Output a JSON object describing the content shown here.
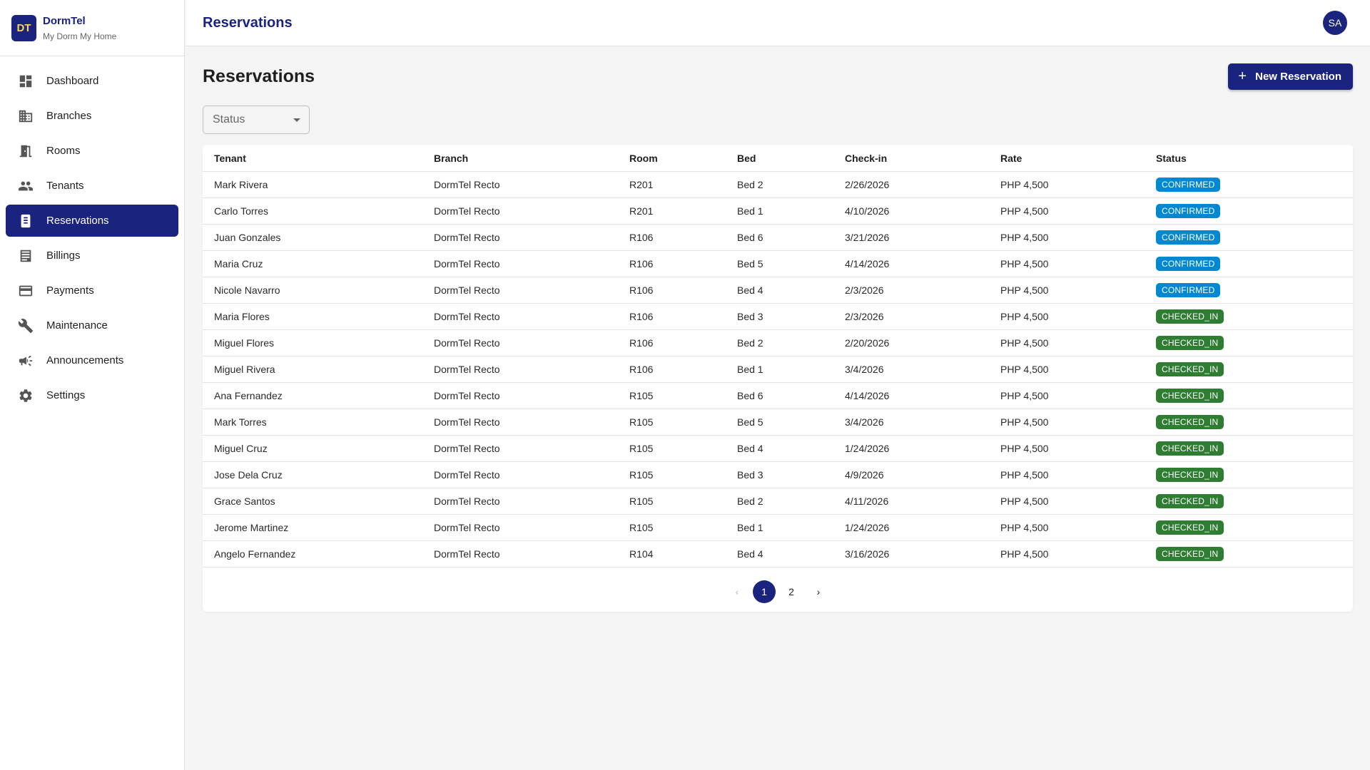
{
  "brand": {
    "logo": "DT",
    "name": "DormTel",
    "tagline": "My Dorm My Home"
  },
  "nav": [
    {
      "label": "Dashboard",
      "icon": "dashboard-icon",
      "active": false
    },
    {
      "label": "Branches",
      "icon": "building-icon",
      "active": false
    },
    {
      "label": "Rooms",
      "icon": "door-icon",
      "active": false
    },
    {
      "label": "Tenants",
      "icon": "people-icon",
      "active": false
    },
    {
      "label": "Reservations",
      "icon": "reservation-icon",
      "active": true
    },
    {
      "label": "Billings",
      "icon": "receipt-icon",
      "active": false
    },
    {
      "label": "Payments",
      "icon": "credit-card-icon",
      "active": false
    },
    {
      "label": "Maintenance",
      "icon": "wrench-icon",
      "active": false
    },
    {
      "label": "Announcements",
      "icon": "megaphone-icon",
      "active": false
    },
    {
      "label": "Settings",
      "icon": "gear-icon",
      "active": false
    }
  ],
  "topbar": {
    "title": "Reservations",
    "avatar": "SA"
  },
  "page": {
    "title": "Reservations",
    "new_button": "New Reservation",
    "plus": "+"
  },
  "filter": {
    "status_label": "Status"
  },
  "table": {
    "headers": [
      "Tenant",
      "Branch",
      "Room",
      "Bed",
      "Check-in",
      "Rate",
      "Status"
    ],
    "rows": [
      [
        "Mark Rivera",
        "DormTel Recto",
        "R201",
        "Bed 2",
        "2/26/2026",
        "PHP 4,500",
        "CONFIRMED"
      ],
      [
        "Carlo Torres",
        "DormTel Recto",
        "R201",
        "Bed 1",
        "4/10/2026",
        "PHP 4,500",
        "CONFIRMED"
      ],
      [
        "Juan Gonzales",
        "DormTel Recto",
        "R106",
        "Bed 6",
        "3/21/2026",
        "PHP 4,500",
        "CONFIRMED"
      ],
      [
        "Maria Cruz",
        "DormTel Recto",
        "R106",
        "Bed 5",
        "4/14/2026",
        "PHP 4,500",
        "CONFIRMED"
      ],
      [
        "Nicole Navarro",
        "DormTel Recto",
        "R106",
        "Bed 4",
        "2/3/2026",
        "PHP 4,500",
        "CONFIRMED"
      ],
      [
        "Maria Flores",
        "DormTel Recto",
        "R106",
        "Bed 3",
        "2/3/2026",
        "PHP 4,500",
        "CHECKED_IN"
      ],
      [
        "Miguel Flores",
        "DormTel Recto",
        "R106",
        "Bed 2",
        "2/20/2026",
        "PHP 4,500",
        "CHECKED_IN"
      ],
      [
        "Miguel Rivera",
        "DormTel Recto",
        "R106",
        "Bed 1",
        "3/4/2026",
        "PHP 4,500",
        "CHECKED_IN"
      ],
      [
        "Ana Fernandez",
        "DormTel Recto",
        "R105",
        "Bed 6",
        "4/14/2026",
        "PHP 4,500",
        "CHECKED_IN"
      ],
      [
        "Mark Torres",
        "DormTel Recto",
        "R105",
        "Bed 5",
        "3/4/2026",
        "PHP 4,500",
        "CHECKED_IN"
      ],
      [
        "Miguel Cruz",
        "DormTel Recto",
        "R105",
        "Bed 4",
        "1/24/2026",
        "PHP 4,500",
        "CHECKED_IN"
      ],
      [
        "Jose Dela Cruz",
        "DormTel Recto",
        "R105",
        "Bed 3",
        "4/9/2026",
        "PHP 4,500",
        "CHECKED_IN"
      ],
      [
        "Grace Santos",
        "DormTel Recto",
        "R105",
        "Bed 2",
        "4/11/2026",
        "PHP 4,500",
        "CHECKED_IN"
      ],
      [
        "Jerome Martinez",
        "DormTel Recto",
        "R105",
        "Bed 1",
        "1/24/2026",
        "PHP 4,500",
        "CHECKED_IN"
      ],
      [
        "Angelo Fernandez",
        "DormTel Recto",
        "R104",
        "Bed 4",
        "3/16/2026",
        "PHP 4,500",
        "CHECKED_IN"
      ]
    ]
  },
  "pagination": {
    "prev": "‹",
    "pages": [
      "1",
      "2"
    ],
    "current": "1",
    "next": "›"
  },
  "colors": {
    "primary": "#1a237e",
    "confirmed": "#0288d1",
    "checked_in": "#2e7d32",
    "logo_text": "#ffd54f"
  }
}
